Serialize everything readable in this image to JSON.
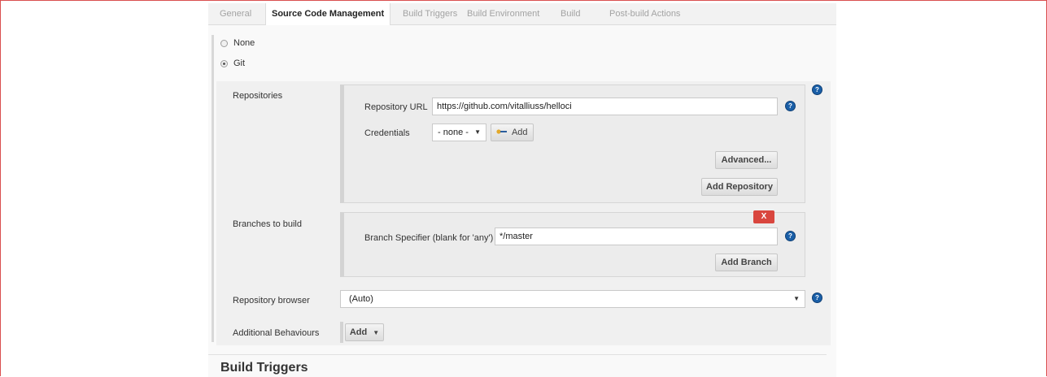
{
  "tabs": [
    {
      "label": "General",
      "active": false
    },
    {
      "label": "Source Code Management",
      "active": true
    },
    {
      "label": "Build Triggers",
      "active": false
    },
    {
      "label": "Build Environment",
      "active": false
    },
    {
      "label": "Build",
      "active": false
    },
    {
      "label": "Post-build Actions",
      "active": false
    }
  ],
  "scm": {
    "options": [
      {
        "label": "None",
        "selected": false
      },
      {
        "label": "Git",
        "selected": true
      }
    ]
  },
  "repositories": {
    "label": "Repositories",
    "url_label": "Repository URL",
    "url_value": "https://github.com/vitalliuss/helloci",
    "credentials_label": "Credentials",
    "credentials_value": "- none -",
    "add_label": "Add",
    "advanced_label": "Advanced...",
    "add_repository_label": "Add Repository"
  },
  "branches": {
    "label": "Branches to build",
    "delete_label": "X",
    "specifier_label": "Branch Specifier (blank for 'any')",
    "specifier_value": "*/master",
    "add_branch_label": "Add Branch"
  },
  "repository_browser": {
    "label": "Repository browser",
    "value": "(Auto)"
  },
  "additional_behaviours": {
    "label": "Additional Behaviours",
    "add_label": "Add"
  },
  "next_section": {
    "title": "Build Triggers"
  },
  "icons": {
    "help": "?",
    "caret": "▼",
    "key": "key-icon"
  },
  "colors": {
    "help_blue": "#1a5fa8",
    "delete_red": "#d9463e",
    "frame_red": "#d94f4f"
  }
}
